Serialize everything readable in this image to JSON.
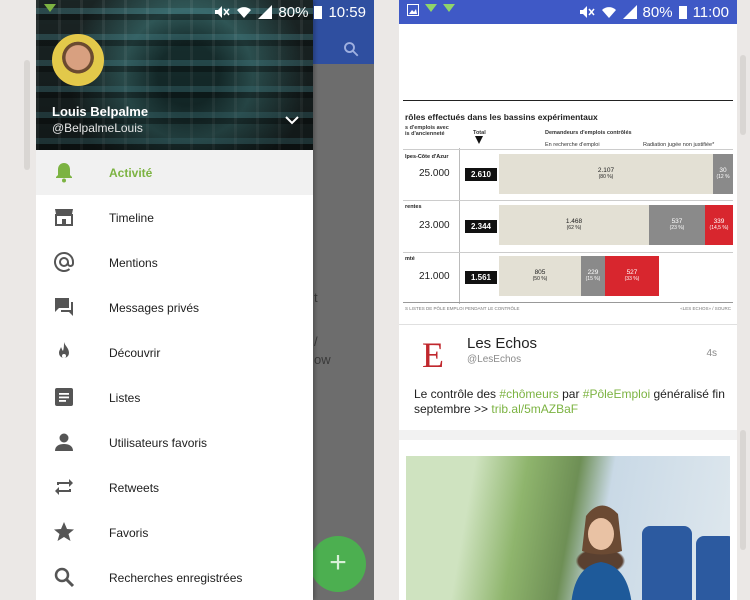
{
  "left_screen": {
    "status": {
      "battery": "80%",
      "time": "10:59"
    },
    "user": {
      "name": "Louis Belpalme",
      "handle": "@BelpalmeLouis"
    },
    "menu": [
      {
        "label": "Activité",
        "icon": "bell-icon",
        "active": true
      },
      {
        "label": "Timeline",
        "icon": "home-store-icon"
      },
      {
        "label": "Mentions",
        "icon": "at-icon"
      },
      {
        "label": "Messages privés",
        "icon": "chat-icon"
      },
      {
        "label": "Découvrir",
        "icon": "flame-icon"
      },
      {
        "label": "Listes",
        "icon": "list-icon"
      },
      {
        "label": "Utilisateurs favoris",
        "icon": "person-icon"
      },
      {
        "label": "Retweets",
        "icon": "retweet-icon"
      },
      {
        "label": "Favoris",
        "icon": "star-icon"
      },
      {
        "label": "Recherches enregistrées",
        "icon": "search-icon"
      }
    ],
    "behind": {
      "text_1": "t",
      "text_2": "/",
      "text_3": "ow"
    },
    "fab_label": "+"
  },
  "right_screen": {
    "status": {
      "battery": "80%",
      "time": "11:00"
    },
    "chart": {
      "title": "rôles effectués dans les bassins expérimentaux",
      "col_note_1": "s d'emplois avec",
      "col_note_2": "is d'ancienneté",
      "col_total": "Total",
      "col_demandeurs": "Demandeurs d'emplois contrôlés",
      "col_recherche": "En recherche d'emploi",
      "col_radiation": "Radiation jugée non justifiée*",
      "rows": [
        {
          "label": "lpes-Côte d'Azur",
          "total": "25.000",
          "box": "2.610",
          "beige": "2.107",
          "beige_pct": "(80 %)",
          "gray": "30",
          "gray_pct": "(12 %",
          "red": "",
          "red_pct": ""
        },
        {
          "label": "rentes",
          "total": "23.000",
          "box": "2.344",
          "beige": "1.468",
          "beige_pct": "(62 %)",
          "gray": "537",
          "gray_pct": "(23 %)",
          "red": "339",
          "red_pct": "(14,5 %)"
        },
        {
          "label": "mté",
          "total": "21.000",
          "box": "1.561",
          "beige": "805",
          "beige_pct": "(50 %)",
          "gray": "229",
          "gray_pct": "(15 %)",
          "red": "527",
          "red_pct": "(33 %)"
        }
      ],
      "source_left": "S LISTES DE PÔLE EMPLOI PENDANT LE CONTRÔLE",
      "source_right": "«LES ECHOS» / SOURC"
    },
    "tweet": {
      "name": "Les Echos",
      "handle": "@LesEchos",
      "time": "4s",
      "text_1": "Le contrôle des ",
      "tag_1": "#chômeurs",
      "text_2": " par ",
      "tag_2": "#PôleEmploi",
      "text_3": " généralisé fin septembre >> ",
      "link": "trib.al/5mAZBaF"
    },
    "colors": {
      "accent_green": "#7cb342",
      "status_blue": "#3f59c6",
      "bar_red": "#d8262e"
    }
  }
}
